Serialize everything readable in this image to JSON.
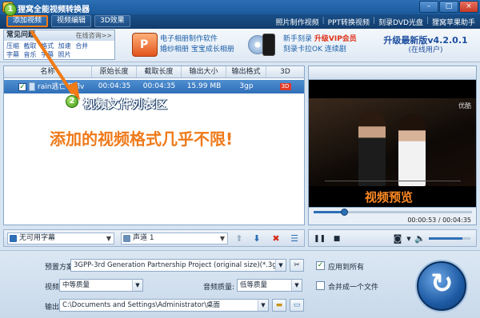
{
  "app": {
    "title": "狸窝全能视频转换器"
  },
  "menubar": {
    "tabs": [
      {
        "label": "添加视频"
      },
      {
        "label": "视频编辑"
      },
      {
        "label": "3D效果"
      }
    ],
    "links": [
      "照片制作视频",
      "PPT转换视频",
      "刻录DVD光盘",
      "狸窝苹果助手"
    ]
  },
  "banner": {
    "faq_title": "常见问题",
    "faq_more": "在线咨询>>",
    "faq_items": [
      "压缩",
      "截取",
      "格式",
      "加速",
      "合并",
      "字幕",
      "音乐",
      "字幕",
      "照片"
    ],
    "promo1_lines": [
      "电子相册制作软件",
      "婚纱相册 宝宝成长相册"
    ],
    "promo2_line1": "新手刻录",
    "promo2_vip": "升级VIP会员",
    "promo2_line2": "刻录卡拉OK 连续剧",
    "version": "升级最新版v4.2.0.1",
    "version_sub": "(在线用户)"
  },
  "list": {
    "columns": [
      "名称",
      "原始长度",
      "截取长度",
      "输出大小",
      "输出格式",
      "3D"
    ],
    "rows": [
      {
        "checked": "✓",
        "name": "rain逃亡者.flv",
        "orig_len": "00:04:35",
        "cut_len": "00:04:35",
        "size": "15.99 MB",
        "format": "3gp",
        "three_d": "3D"
      }
    ]
  },
  "annotations": {
    "marker1": "1",
    "marker2": "2",
    "list_area": "视频文件列表区",
    "formats_note": "添加的视频格式几乎不限!",
    "preview_label": "视频预览"
  },
  "preview": {
    "watermark": "优酷",
    "time_current": "00:00:53",
    "time_total": "00:04:35",
    "progress_fraction": 0.19,
    "volume_fraction": 0.8
  },
  "toolbar": {
    "subtitle": "无可用字幕",
    "audio": "声道 1"
  },
  "settings": {
    "preset_label": "预置方案:",
    "preset_value": "3GPP-3rd Generation Partnership Project (original size)(*.3gp)",
    "video_quality_label": "视频质量:",
    "video_quality_value": "中等质量",
    "audio_quality_label": "音频质量:",
    "audio_quality_value": "低等质量",
    "output_label": "输出目录:",
    "output_value": "C:\\Documents and Settings\\Administrator\\桌面",
    "apply_all_label": "应用到所有",
    "apply_all_checked": "✓",
    "merge_label": "合并成一个文件"
  },
  "colors": {
    "accent": "#f07a15",
    "brand": "#1b5a9c",
    "selected": "#2f6fb8"
  }
}
